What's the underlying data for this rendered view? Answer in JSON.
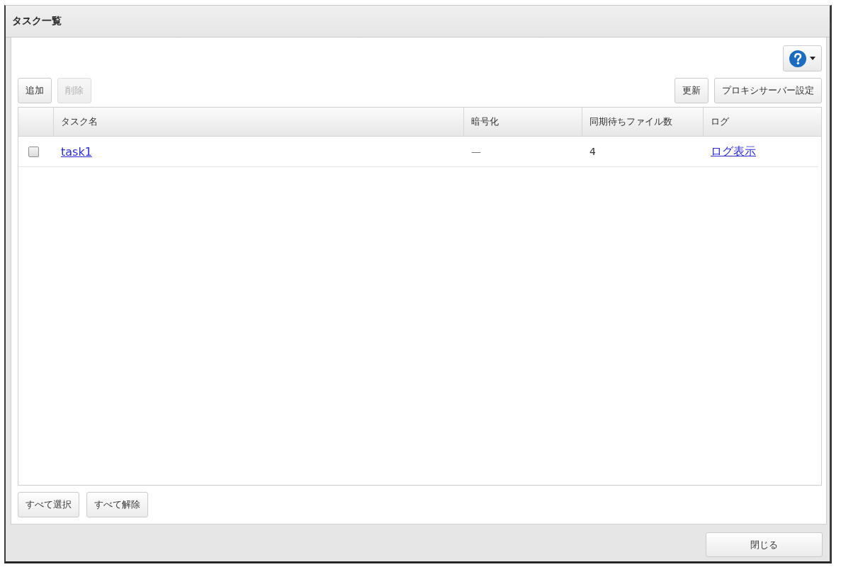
{
  "window": {
    "title": "タスク一覧"
  },
  "toolbar": {
    "left_buttons": [
      {
        "label": "追加",
        "disabled": false
      },
      {
        "label": "削除",
        "disabled": true
      }
    ],
    "right_buttons": [
      {
        "label": "更新",
        "disabled": false
      },
      {
        "label": "プロキシサーバー設定",
        "disabled": false
      }
    ]
  },
  "table": {
    "columns": [
      "タスク名",
      "暗号化",
      "同期待ちファイル数",
      "ログ"
    ],
    "rows": [
      {
        "checked": false,
        "task_name": "task1",
        "encryption": "—",
        "pending_files": "4",
        "log_link": "ログ表示"
      }
    ]
  },
  "selection_buttons": [
    "すべて選択",
    "すべて解除"
  ],
  "footer": {
    "close_button": "閉じる"
  }
}
